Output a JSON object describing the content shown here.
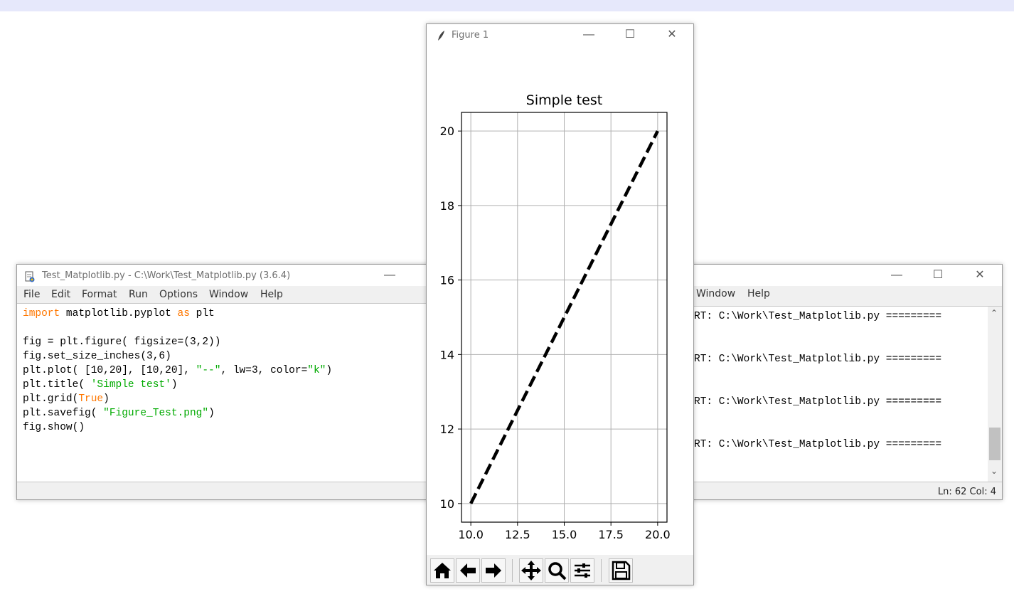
{
  "editor_window": {
    "title": "Test_Matplotlib.py - C:\\Work\\Test_Matplotlib.py (3.6.4)",
    "menu": [
      "File",
      "Edit",
      "Format",
      "Run",
      "Options",
      "Window",
      "Help"
    ],
    "code_lines": [
      "import matplotlib.pyplot as plt",
      "",
      "fig = plt.figure( figsize=(3,2))",
      "fig.set_size_inches(3,6)",
      "plt.plot( [10,20], [10,20], \"--\", lw=3, color=\"k\")",
      "plt.title( 'Simple test')",
      "plt.grid(True)",
      "plt.savefig( \"Figure_Test.png\")",
      "fig.show()"
    ]
  },
  "shell_window": {
    "menu": [
      "Window",
      "Help"
    ],
    "lines": [
      "RT: C:\\Work\\Test_Matplotlib.py =========",
      "RT: C:\\Work\\Test_Matplotlib.py =========",
      "RT: C:\\Work\\Test_Matplotlib.py =========",
      "RT: C:\\Work\\Test_Matplotlib.py ========="
    ],
    "status": "Ln: 62   Col: 4"
  },
  "figure_window": {
    "title": "Figure 1",
    "toolbar_buttons": [
      "home-icon",
      "back-arrow-icon",
      "forward-arrow-icon",
      "pan-icon",
      "zoom-icon",
      "configure-subplots-icon",
      "save-icon"
    ]
  },
  "chart_data": {
    "type": "line",
    "title": "Simple test",
    "xlabel": "",
    "ylabel": "",
    "x": [
      10,
      20
    ],
    "series": [
      {
        "values": [
          10,
          20
        ],
        "line_style": "dashed",
        "color": "#000000"
      }
    ],
    "xlim": [
      9.5,
      20.5
    ],
    "ylim": [
      9.5,
      20.5
    ],
    "x_ticks": [
      10,
      12.5,
      15,
      17.5,
      20
    ],
    "x_tick_labels": [
      "10.0",
      "12.5",
      "15.0",
      "17.5",
      "20.0"
    ],
    "y_ticks": [
      10,
      12,
      14,
      16,
      18,
      20
    ],
    "y_tick_labels": [
      "10",
      "12",
      "14",
      "16",
      "18",
      "20"
    ],
    "grid": true
  }
}
